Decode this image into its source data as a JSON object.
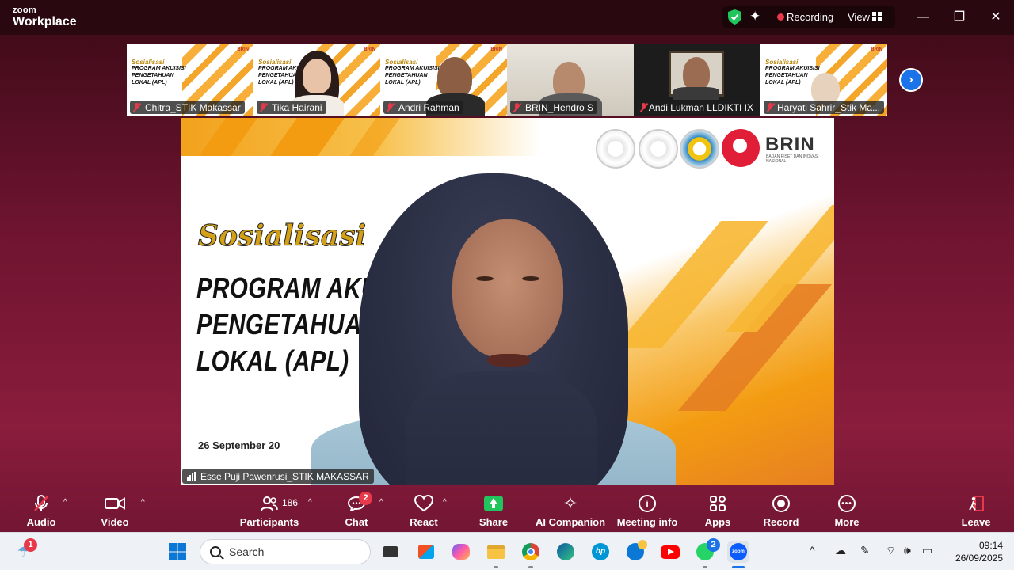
{
  "app": {
    "brand_small": "zoom",
    "brand_large": "Workplace"
  },
  "header": {
    "recording_label": "Recording",
    "view_label": "View"
  },
  "window_controls": {
    "minimize": "—",
    "restore": "❐",
    "close": "✕"
  },
  "thumbnails": [
    {
      "name": "Chitra_STIK Makassar",
      "type": "slide"
    },
    {
      "name": "Tika Hairani",
      "type": "person"
    },
    {
      "name": "Andri Rahman",
      "type": "slide-person"
    },
    {
      "name": "BRIN_Hendro S",
      "type": "room"
    },
    {
      "name": "Andi Lukman LLDIKTI IX",
      "type": "dark"
    },
    {
      "name": "Haryati Sahrir_Stik Ma...",
      "type": "slide-person"
    }
  ],
  "slide": {
    "cursive": "Sosialisasi",
    "title_lines": [
      "PROGRAM AKUISISI",
      "PENGETAHUAN",
      "LOKAL (APL)"
    ],
    "date": "26 September 20",
    "brin": "BRIN",
    "brin_sub": "BADAN RISET DAN INOVASI NASIONAL",
    "thumb_title": "PROGRAM AKUISISI PENGETAHUAN LOKAL (APL)",
    "thumb_cursive": "Sosialisasi",
    "thumb_brin": "BRIN"
  },
  "main_speaker": {
    "name": "Esse Puji Pawenrusi_STIK MAKASSAR"
  },
  "toolbar": {
    "audio": "Audio",
    "video": "Video",
    "participants": "Participants",
    "participants_count": "186",
    "chat": "Chat",
    "chat_badge": "2",
    "react": "React",
    "share": "Share",
    "ai_companion": "AI Companion",
    "meeting_info": "Meeting info",
    "apps": "Apps",
    "record": "Record",
    "more": "More",
    "leave": "Leave"
  },
  "taskbar": {
    "search_placeholder": "Search",
    "weather_badge": "1",
    "whatsapp_badge": "2",
    "time": "09:14",
    "date": "26/09/2025"
  },
  "colors": {
    "accent": "#1a73e8",
    "recording": "#e8394a",
    "share": "#21c45d"
  }
}
